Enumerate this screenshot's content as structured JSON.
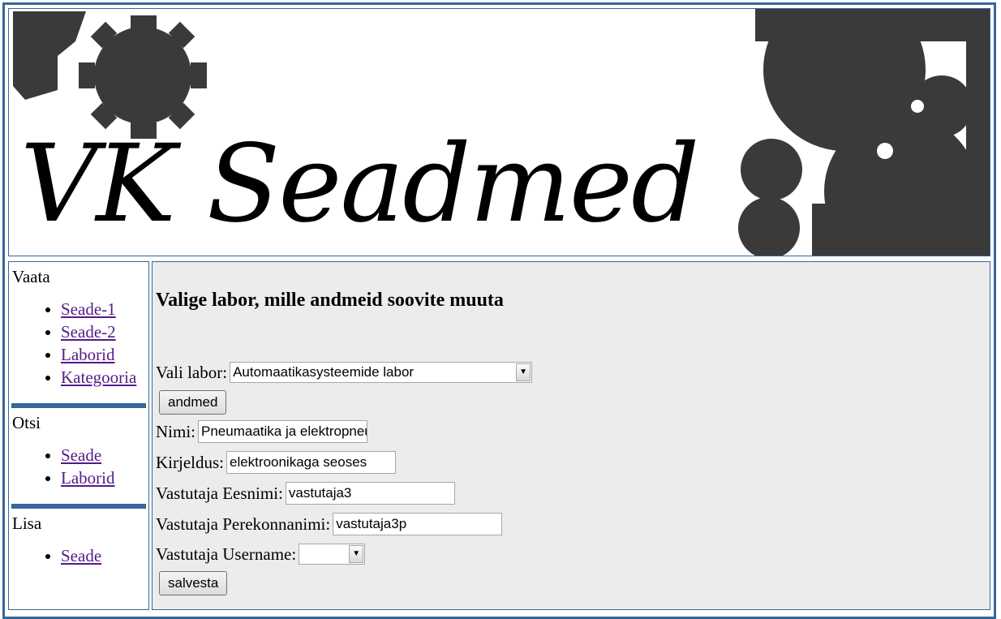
{
  "banner": {
    "title": "VK Seadmed"
  },
  "sidebar": {
    "sections": [
      {
        "heading": "Vaata",
        "links": [
          "Seade-1",
          "Seade-2",
          "Laborid",
          "Kategooria"
        ]
      },
      {
        "heading": "Otsi",
        "links": [
          "Seade",
          "Laborid"
        ]
      },
      {
        "heading": "Lisa",
        "links": [
          "Seade"
        ]
      }
    ]
  },
  "main": {
    "title": "Valige labor, mille andmeid soovite muuta",
    "lab_select": {
      "label": "Vali labor:",
      "value": "Automaatikasysteemide labor"
    },
    "data_button": "andmed",
    "fields": {
      "nimi": {
        "label": "Nimi:",
        "value": "Pneumaatika ja elektropneumaatika"
      },
      "kirjeldus": {
        "label": "Kirjeldus:",
        "value": "elektroonikaga seoses"
      },
      "eesnimi": {
        "label": "Vastutaja Eesnimi:",
        "value": "vastutaja3"
      },
      "perekonnanimi": {
        "label": "Vastutaja Perekonnanimi:",
        "value": "vastutaja3p"
      },
      "username": {
        "label": "Vastutaja Username:",
        "value": ""
      }
    },
    "save_button": "salvesta"
  },
  "colors": {
    "border": "#34679a",
    "gear": "#3a3a3a",
    "link": "#551a8b",
    "main_bg": "#ececec"
  }
}
